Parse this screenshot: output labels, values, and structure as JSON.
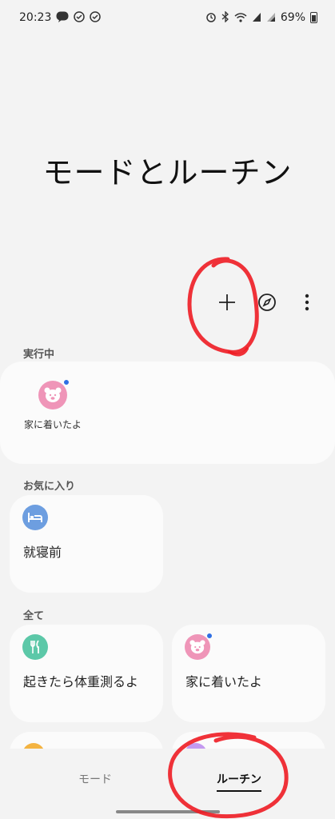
{
  "status_bar": {
    "time": "20:23",
    "battery": "69%",
    "icons": [
      "line-icon",
      "check-circle-icon",
      "check-circle-icon",
      "alarm-icon",
      "bluetooth-icon",
      "wifi-icon",
      "signal-icon",
      "signal-icon",
      "battery-icon"
    ]
  },
  "header": {
    "title": "モードとルーチン"
  },
  "toolbar": {
    "add_icon": "plus-icon",
    "discover_icon": "compass-icon",
    "more_icon": "more-vertical-icon"
  },
  "sections": {
    "running": "実行中",
    "favorites": "お気に入り",
    "all": "全て"
  },
  "running": {
    "items": [
      {
        "label": "家に着いたよ",
        "icon": "bear-face-icon",
        "color": "#ef95b8"
      }
    ]
  },
  "favorites": {
    "items": [
      {
        "label": "就寝前",
        "icon": "bed-icon",
        "color": "#6d9ee0"
      }
    ]
  },
  "all": {
    "items": [
      {
        "label": "起きたら体重測るよ",
        "icon": "cutlery-icon",
        "color": "#5cc8a8"
      },
      {
        "label": "家に着いたよ",
        "icon": "bear-face-icon",
        "color": "#ef95b8"
      }
    ],
    "partial_icons": [
      {
        "color": "#f4b442"
      },
      {
        "color": "#c49af0"
      }
    ]
  },
  "bottom_nav": {
    "tabs": [
      {
        "label": "モード",
        "selected": false
      },
      {
        "label": "ルーチン",
        "selected": true
      }
    ]
  },
  "colors": {
    "annotation": "#ee1c24",
    "background": "#f3f3f3",
    "card": "#fbfbfb"
  }
}
